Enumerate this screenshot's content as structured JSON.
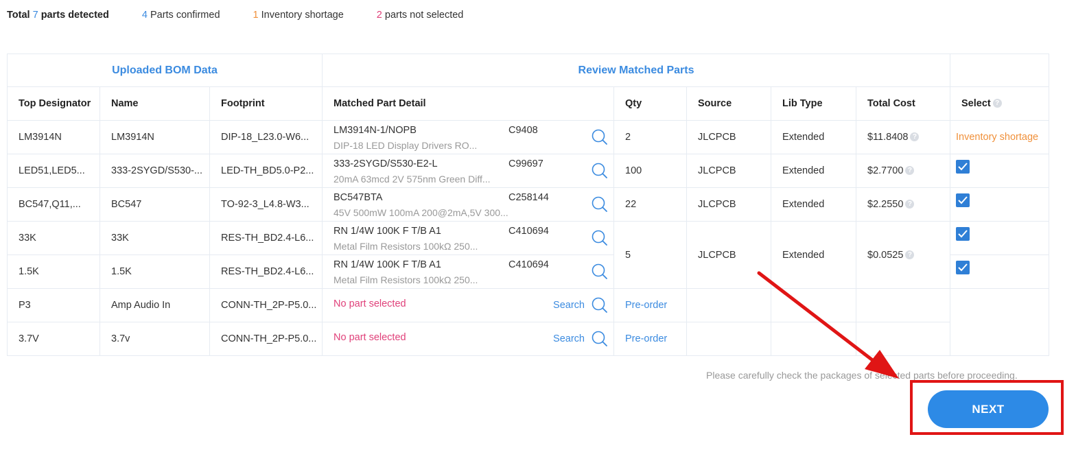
{
  "summary": {
    "total_prefix": "Total",
    "total_count": "7",
    "total_suffix": "parts detected",
    "confirmed_count": "4",
    "confirmed_label": "Parts confirmed",
    "shortage_count": "1",
    "shortage_label": "Inventory shortage",
    "notselected_count": "2",
    "notselected_label": "parts not selected"
  },
  "table": {
    "group_headers": {
      "uploaded": "Uploaded BOM Data",
      "review": "Review Matched Parts"
    },
    "columns": [
      "Top Designator",
      "Name",
      "Footprint",
      "Matched Part Detail",
      "Qty",
      "Source",
      "Lib Type",
      "Total Cost",
      "Select"
    ],
    "rows": [
      {
        "designator": "LM3914N",
        "name": "LM3914N",
        "footprint": "DIP-18_L23.0-W6...",
        "part": "LM3914N-1/NOPB",
        "code": "C9408",
        "desc": "DIP-18 LED Display Drivers RO...",
        "qty": "2",
        "source": "JLCPCB",
        "lib": "Extended",
        "cost": "$11.8408",
        "select": "Inventory shortage"
      },
      {
        "designator": "LED51,LED5...",
        "name": "333-2SYGD/S530-...",
        "footprint": "LED-TH_BD5.0-P2...",
        "part": "333-2SYGD/S530-E2-L",
        "code": "C99697",
        "desc": "20mA 63mcd 2V 575nm Green Diff...",
        "qty": "100",
        "source": "JLCPCB",
        "lib": "Extended",
        "cost": "$2.7700",
        "select": "checked"
      },
      {
        "designator": "BC547,Q11,...",
        "name": "BC547",
        "footprint": "TO-92-3_L4.8-W3...",
        "part": "BC547BTA",
        "code": "C258144",
        "desc": "45V 500mW 100mA 200@2mA,5V 300...",
        "qty": "22",
        "source": "JLCPCB",
        "lib": "Extended",
        "cost": "$2.2550",
        "select": "checked"
      },
      {
        "designator": "33K",
        "name": "33K",
        "footprint": "RES-TH_BD2.4-L6...",
        "part": "RN 1/4W 100K F T/B A1",
        "code": "C410694",
        "desc": "Metal Film Resistors 100kΩ 250...",
        "qty": "5",
        "source": "JLCPCB",
        "lib": "Extended",
        "cost": "$0.0525",
        "select": "checked"
      },
      {
        "designator": "1.5K",
        "name": "1.5K",
        "footprint": "RES-TH_BD2.4-L6...",
        "part": "RN 1/4W 100K F T/B A1",
        "code": "C410694",
        "desc": "Metal Film Resistors 100kΩ 250...",
        "select": "checked"
      },
      {
        "designator": "P3",
        "name": "Amp Audio In",
        "footprint": "CONN-TH_2P-P5.0...",
        "nopart": "No part selected",
        "search": "Search",
        "qty": "Pre-order"
      },
      {
        "designator": "3.7V",
        "name": "3.7v",
        "footprint": "CONN-TH_2P-P5.0...",
        "nopart": "No part selected",
        "search": "Search",
        "qty": "Pre-order"
      }
    ]
  },
  "note": "Please carefully check the packages of selected parts before proceeding.",
  "next_label": "NEXT",
  "colors": {
    "accent": "#2d8ae6",
    "shortage": "#f0903a",
    "warning": "#e0417a",
    "highlight": "#e01515"
  }
}
